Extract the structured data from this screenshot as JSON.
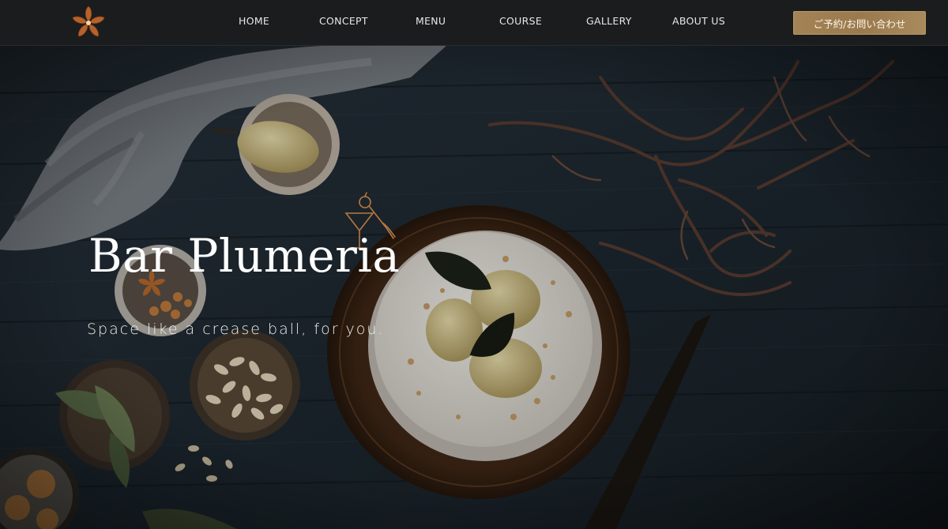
{
  "header": {
    "logo_icon": "plumeria-flower-icon",
    "nav": [
      {
        "label": "HOME"
      },
      {
        "label": "CONCEPT"
      },
      {
        "label": "MENU"
      },
      {
        "label": "COURSE"
      },
      {
        "label": "GALLERY"
      },
      {
        "label": "ABOUT US"
      }
    ],
    "reserve_label": "ご予約/お問い合わせ"
  },
  "hero": {
    "title": "Bar Plumeria",
    "subtitle": "Space like a crease ball, for you.",
    "decoration_icon": "cocktail-glass-icon"
  },
  "colors": {
    "header_bg": "#1b1c1d",
    "button_gold": "#a48356",
    "logo_copper": "#b4632c",
    "background_wood": "#1f2a33"
  }
}
